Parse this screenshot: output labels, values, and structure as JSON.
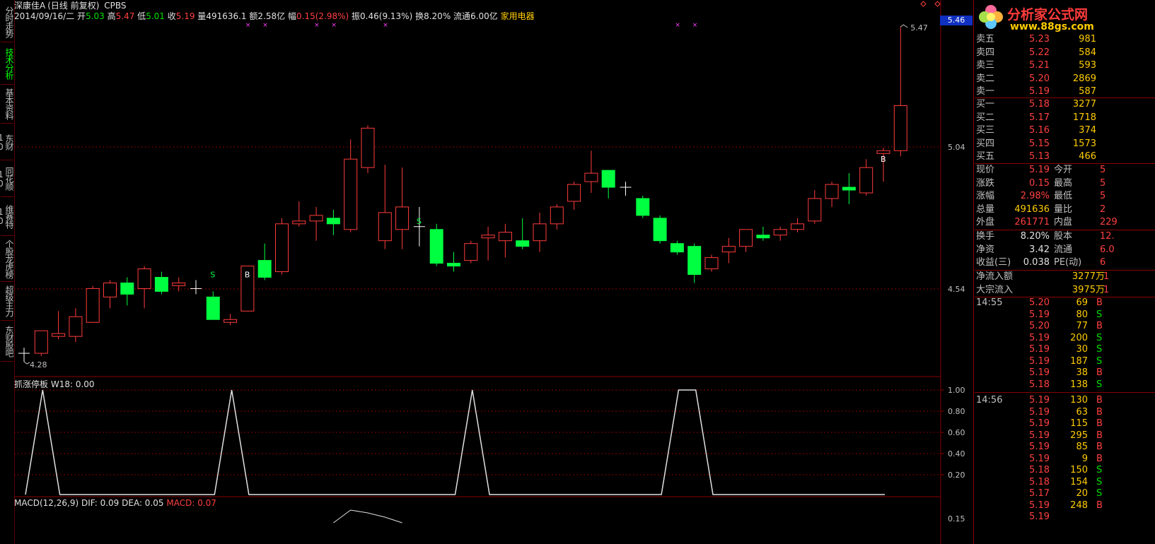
{
  "left_tabs": [
    "分时走势",
    "技术分析",
    "基本资料",
    "东财10",
    "同花顺10",
    "维赛特10",
    "个股龙虎榜",
    "超级主力",
    "东财股吧"
  ],
  "info": {
    "name": "深康佳A",
    "period": "(日线 前复权)",
    "indicator": "CPBS",
    "date": "2014/09/16/二",
    "open_label": "开",
    "open": "5.03",
    "high_label": "高",
    "high": "5.47",
    "low_label": "低",
    "low": "5.01",
    "close_label": "收",
    "close": "5.19",
    "vol_label": "量",
    "vol": "491636.1",
    "amt_label": "额",
    "amt": "2.58亿",
    "chg_label": "幅",
    "chg": "0.15(2.98%)",
    "amp_label": "振",
    "amp": "0.46(9.13%)",
    "turn_label": "换",
    "turn": "8.20%",
    "float_label": "流通",
    "float": "6.00亿",
    "industry": "家用电器"
  },
  "price_axis": {
    "top_label": "5.46",
    "mid_label": "5.04",
    "low_label": "4.54"
  },
  "annotations": {
    "max_label": "5.47",
    "min_label": "4.28"
  },
  "sub1": {
    "title": "抓涨停板",
    "value": "W18: 0.00",
    "ticks": [
      "1.00",
      "0.80",
      "0.60",
      "0.40",
      "0.20"
    ]
  },
  "sub2": {
    "title": "MACD(12,26,9)",
    "dif": "DIF: 0.09",
    "dea": "DEA: 0.05",
    "macd": "MACD: 0.07",
    "tick": "0.15"
  },
  "candles": [
    {
      "o": 4.31,
      "c": 4.31,
      "h": 4.33,
      "l": 4.28
    },
    {
      "o": 4.31,
      "c": 4.39,
      "h": 4.39,
      "l": 4.3
    },
    {
      "o": 4.37,
      "c": 4.38,
      "h": 4.46,
      "l": 4.36
    },
    {
      "o": 4.37,
      "c": 4.44,
      "h": 4.47,
      "l": 4.35
    },
    {
      "o": 4.42,
      "c": 4.54,
      "h": 4.55,
      "l": 4.42
    },
    {
      "o": 4.51,
      "c": 4.56,
      "h": 4.57,
      "l": 4.47
    },
    {
      "o": 4.56,
      "c": 4.52,
      "h": 4.58,
      "l": 4.48
    },
    {
      "o": 4.54,
      "c": 4.61,
      "h": 4.62,
      "l": 4.47
    },
    {
      "o": 4.58,
      "c": 4.53,
      "h": 4.6,
      "l": 4.52
    },
    {
      "o": 4.55,
      "c": 4.56,
      "h": 4.58,
      "l": 4.53
    },
    {
      "o": 4.54,
      "c": 4.54,
      "h": 4.57,
      "l": 4.52
    },
    {
      "o": 4.51,
      "c": 4.43,
      "h": 4.53,
      "l": 4.43
    },
    {
      "o": 4.42,
      "c": 4.43,
      "h": 4.45,
      "l": 4.41
    },
    {
      "o": 4.46,
      "c": 4.62,
      "h": 4.62,
      "l": 4.46
    },
    {
      "o": 4.64,
      "c": 4.58,
      "h": 4.7,
      "l": 4.57
    },
    {
      "o": 4.6,
      "c": 4.77,
      "h": 4.79,
      "l": 4.59
    },
    {
      "o": 4.77,
      "c": 4.78,
      "h": 4.85,
      "l": 4.76
    },
    {
      "o": 4.78,
      "c": 4.8,
      "h": 4.83,
      "l": 4.71
    },
    {
      "o": 4.79,
      "c": 4.77,
      "h": 4.82,
      "l": 4.73
    },
    {
      "o": 4.75,
      "c": 5.0,
      "h": 5.07,
      "l": 4.74
    },
    {
      "o": 4.97,
      "c": 5.11,
      "h": 5.12,
      "l": 4.95
    },
    {
      "o": 4.71,
      "c": 4.81,
      "h": 4.98,
      "l": 4.68
    },
    {
      "o": 4.75,
      "c": 4.83,
      "h": 4.97,
      "l": 4.68
    },
    {
      "o": 4.76,
      "c": 4.76,
      "h": 4.83,
      "l": 4.69
    },
    {
      "o": 4.75,
      "c": 4.63,
      "h": 4.77,
      "l": 4.62
    },
    {
      "o": 4.63,
      "c": 4.62,
      "h": 4.67,
      "l": 4.6
    },
    {
      "o": 4.64,
      "c": 4.7,
      "h": 4.71,
      "l": 4.63
    },
    {
      "o": 4.72,
      "c": 4.73,
      "h": 4.76,
      "l": 4.64
    },
    {
      "o": 4.71,
      "c": 4.74,
      "h": 4.77,
      "l": 4.65
    },
    {
      "o": 4.71,
      "c": 4.69,
      "h": 4.79,
      "l": 4.68
    },
    {
      "o": 4.71,
      "c": 4.77,
      "h": 4.81,
      "l": 4.67
    },
    {
      "o": 4.77,
      "c": 4.83,
      "h": 4.84,
      "l": 4.75
    },
    {
      "o": 4.85,
      "c": 4.91,
      "h": 4.92,
      "l": 4.82
    },
    {
      "o": 4.92,
      "c": 4.95,
      "h": 5.03,
      "l": 4.88
    },
    {
      "o": 4.96,
      "c": 4.9,
      "h": 4.96,
      "l": 4.86
    },
    {
      "o": 4.9,
      "c": 4.9,
      "h": 4.92,
      "l": 4.87
    },
    {
      "o": 4.86,
      "c": 4.8,
      "h": 4.87,
      "l": 4.79
    },
    {
      "o": 4.79,
      "c": 4.71,
      "h": 4.8,
      "l": 4.7
    },
    {
      "o": 4.7,
      "c": 4.67,
      "h": 4.71,
      "l": 4.66
    },
    {
      "o": 4.69,
      "c": 4.59,
      "h": 4.7,
      "l": 4.56
    },
    {
      "o": 4.61,
      "c": 4.65,
      "h": 4.66,
      "l": 4.6
    },
    {
      "o": 4.67,
      "c": 4.69,
      "h": 4.72,
      "l": 4.63
    },
    {
      "o": 4.69,
      "c": 4.75,
      "h": 4.75,
      "l": 4.67
    },
    {
      "o": 4.73,
      "c": 4.72,
      "h": 4.76,
      "l": 4.71
    },
    {
      "o": 4.73,
      "c": 4.75,
      "h": 4.76,
      "l": 4.71
    },
    {
      "o": 4.75,
      "c": 4.77,
      "h": 4.79,
      "l": 4.74
    },
    {
      "o": 4.78,
      "c": 4.86,
      "h": 4.89,
      "l": 4.77
    },
    {
      "o": 4.86,
      "c": 4.91,
      "h": 4.92,
      "l": 4.83
    },
    {
      "o": 4.9,
      "c": 4.89,
      "h": 4.95,
      "l": 4.84
    },
    {
      "o": 4.88,
      "c": 4.97,
      "h": 5.0,
      "l": 4.87
    },
    {
      "o": 5.02,
      "c": 5.03,
      "h": 5.04,
      "l": 4.92
    },
    {
      "o": 5.03,
      "c": 5.19,
      "h": 5.47,
      "l": 5.01
    }
  ],
  "wave": [
    0,
    1,
    0,
    0,
    0,
    0,
    0,
    0,
    0,
    0,
    0,
    0,
    1,
    0,
    0,
    0,
    0,
    0,
    0,
    0,
    0,
    0,
    0,
    0,
    0,
    0,
    1,
    0,
    0,
    0,
    0,
    0,
    0,
    0,
    0,
    0,
    0,
    0,
    1,
    1,
    0,
    0,
    0,
    0,
    0,
    0,
    0,
    0,
    0,
    0,
    0
  ],
  "orderbook": {
    "asks": [
      {
        "label": "卖五",
        "price": "5.23",
        "vol": "981"
      },
      {
        "label": "卖四",
        "price": "5.22",
        "vol": "584"
      },
      {
        "label": "卖三",
        "price": "5.21",
        "vol": "593"
      },
      {
        "label": "卖二",
        "price": "5.20",
        "vol": "2869"
      },
      {
        "label": "卖一",
        "price": "5.19",
        "vol": "587"
      }
    ],
    "bids": [
      {
        "label": "买一",
        "price": "5.18",
        "vol": "3277"
      },
      {
        "label": "买二",
        "price": "5.17",
        "vol": "1718"
      },
      {
        "label": "买三",
        "price": "5.16",
        "vol": "374"
      },
      {
        "label": "买四",
        "price": "5.15",
        "vol": "1573"
      },
      {
        "label": "买五",
        "price": "5.13",
        "vol": "466"
      }
    ]
  },
  "stats": [
    {
      "l1": "现价",
      "v1": "5.19",
      "c1": "red",
      "l2": "今开",
      "v2": "5",
      "c2": "red"
    },
    {
      "l1": "涨跌",
      "v1": "0.15",
      "c1": "red",
      "l2": "最高",
      "v2": "5",
      "c2": "red"
    },
    {
      "l1": "涨幅",
      "v1": "2.98%",
      "c1": "red",
      "l2": "最低",
      "v2": "5",
      "c2": "red"
    },
    {
      "l1": "总量",
      "v1": "491636",
      "c1": "yellow",
      "l2": "量比",
      "v2": "2",
      "c2": "red"
    },
    {
      "l1": "外盘",
      "v1": "261771",
      "c1": "red",
      "l2": "内盘",
      "v2": "229",
      "c2": "green"
    }
  ],
  "stats2": [
    {
      "l1": "换手",
      "v1": "8.20%",
      "c1": "white",
      "l2": "股本",
      "v2": "12.",
      "c2": "white"
    },
    {
      "l1": "净资",
      "v1": "3.42",
      "c1": "white",
      "l2": "流通",
      "v2": "6.0",
      "c2": "white"
    },
    {
      "l1": "收益(三)",
      "v1": "0.038",
      "c1": "white",
      "l2": "PE(动)",
      "v2": "6",
      "c2": "white"
    }
  ],
  "flows": [
    {
      "label": "净流入额",
      "value": "3277万",
      "extra": "1"
    },
    {
      "label": "大宗流入",
      "value": "3975万",
      "extra": "1"
    }
  ],
  "ticks": [
    {
      "time": "14:55",
      "price": "5.20",
      "vol": "69",
      "side": "B"
    },
    {
      "time": "",
      "price": "5.19",
      "vol": "80",
      "side": "S"
    },
    {
      "time": "",
      "price": "5.20",
      "vol": "77",
      "side": "B"
    },
    {
      "time": "",
      "price": "5.19",
      "vol": "200",
      "side": "S"
    },
    {
      "time": "",
      "price": "5.19",
      "vol": "30",
      "side": "S"
    },
    {
      "time": "",
      "price": "5.19",
      "vol": "187",
      "side": "S"
    },
    {
      "time": "",
      "price": "5.19",
      "vol": "38",
      "side": "B"
    },
    {
      "time": "",
      "price": "5.18",
      "vol": "138",
      "side": "S"
    },
    {
      "time": "14:56",
      "price": "5.19",
      "vol": "130",
      "side": "B"
    },
    {
      "time": "",
      "price": "5.19",
      "vol": "63",
      "side": "B"
    },
    {
      "time": "",
      "price": "5.19",
      "vol": "115",
      "side": "B"
    },
    {
      "time": "",
      "price": "5.19",
      "vol": "295",
      "side": "B"
    },
    {
      "time": "",
      "price": "5.19",
      "vol": "85",
      "side": "B"
    },
    {
      "time": "",
      "price": "5.19",
      "vol": "9",
      "side": "B"
    },
    {
      "time": "",
      "price": "5.18",
      "vol": "150",
      "side": "S"
    },
    {
      "time": "",
      "price": "5.18",
      "vol": "154",
      "side": "S"
    },
    {
      "time": "",
      "price": "5.17",
      "vol": "20",
      "side": "S"
    },
    {
      "time": "",
      "price": "5.19",
      "vol": "248",
      "side": "B"
    },
    {
      "time": "",
      "price": "5.19",
      "vol": "",
      "side": ""
    }
  ],
  "logo": {
    "title": "分析家公式网",
    "url": "www.88gs.com"
  },
  "markers": {
    "s1": "S",
    "s2": "S",
    "b1": "B",
    "b2": "B"
  },
  "colors": {
    "up": "#ff3b3b",
    "down": "#00ff40",
    "grid": "#8a0000"
  }
}
